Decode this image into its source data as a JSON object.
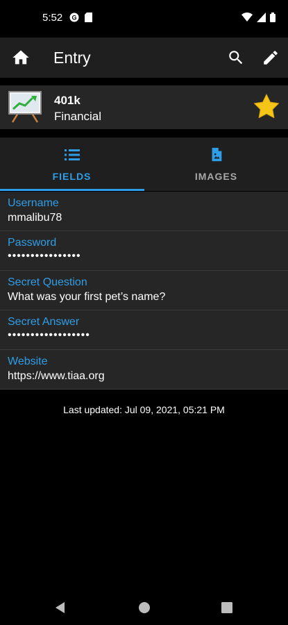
{
  "status_bar": {
    "time": "5:52"
  },
  "app_bar": {
    "title": "Entry"
  },
  "entry": {
    "name": "401k",
    "category": "Financial"
  },
  "tabs": [
    {
      "label": "FIELDS",
      "icon": "list-icon",
      "active": true
    },
    {
      "label": "IMAGES",
      "icon": "image-file-icon",
      "active": false
    }
  ],
  "fields": [
    {
      "label": "Username",
      "value": "mmalibu78"
    },
    {
      "label": "Password",
      "value": "••••••••••••••••"
    },
    {
      "label": "Secret Question",
      "value": "What was your first pet’s name?"
    },
    {
      "label": "Secret Answer",
      "value": "••••••••••••••••••"
    },
    {
      "label": "Website",
      "value": "https://www.tiaa.org"
    }
  ],
  "last_updated": "Last updated: Jul 09, 2021, 05:21 PM",
  "colors": {
    "accent": "#2f9ee8",
    "star": "#f5c518",
    "surface": "#262626",
    "appbar": "#1f1f1f"
  }
}
